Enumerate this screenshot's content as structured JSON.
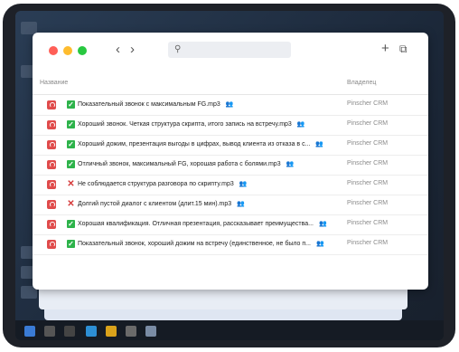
{
  "window": {
    "columns": {
      "name": "Название",
      "owner": "Владелец"
    },
    "toolbar": {
      "back": "‹",
      "forward": "›",
      "search_placeholder": "",
      "add": "+",
      "copy": "⧉"
    },
    "rows": [
      {
        "status": "none",
        "name": "Показательный звонок с максимальным FG.mp3",
        "owner": "Pinscher CRM",
        "shared": "👥"
      },
      {
        "status": "ok",
        "name": "Хороший звонок. Четкая структура скрипта, итого запись на встречу.mp3",
        "owner": "Pinscher CRM",
        "shared": "👥"
      },
      {
        "status": "ok",
        "name": "Хороший дожим, презентация выгоды в цифрах, вывод клиента из отказа в с...",
        "owner": "Pinscher CRM",
        "shared": "👥"
      },
      {
        "status": "ok",
        "name": "Отличный звонок, максимальный FG, хорошая работа с болями.mp3",
        "owner": "Pinscher CRM",
        "shared": "👥"
      },
      {
        "status": "bad",
        "name": "Не соблюдается структура разговора по скрипту.mp3",
        "owner": "Pinscher CRM",
        "shared": "👥"
      },
      {
        "status": "bad",
        "name": "Долгий  пустой  диалог с клиентом (длит.15 мин).mp3",
        "owner": "Pinscher CRM",
        "shared": "👥"
      },
      {
        "status": "ok",
        "name": "Хорошая квалификация. Отличная презентация, рассказывает преимущества...",
        "owner": "Pinscher CRM",
        "shared": "👥"
      },
      {
        "status": "ok",
        "name": "Показательный звонок, хороший дожим на встречу (единственное, не было п...",
        "owner": "Pinscher CRM",
        "shared": "👥"
      }
    ],
    "icons": {
      "file": "audio-file-icon",
      "ok": "check-icon",
      "bad": "cross-icon",
      "shared": "shared-users-icon"
    },
    "colors": {
      "close": "#ff5f57",
      "minimize": "#febc2e",
      "maximize": "#28c840",
      "audio_file": "#e04b4b",
      "ok": "#2db34a",
      "bad": "#d63b3b"
    }
  }
}
